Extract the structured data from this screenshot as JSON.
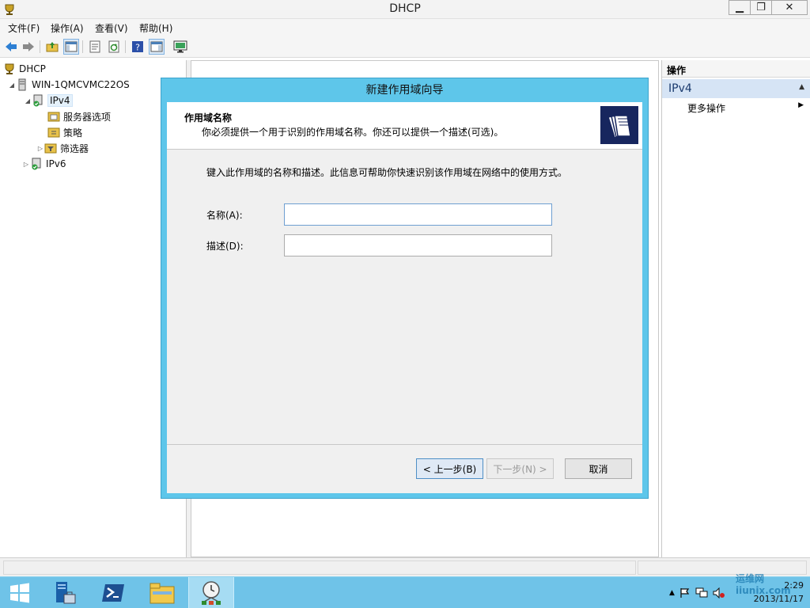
{
  "window": {
    "title": "DHCP",
    "min_glyph": "▁",
    "max_glyph": "❐",
    "close_glyph": "✕"
  },
  "menu": [
    "文件(F)",
    "操作(A)",
    "查看(V)",
    "帮助(H)"
  ],
  "toolbar": {
    "icons": [
      "back-arrow-icon",
      "forward-arrow-icon",
      "folder-up-icon",
      "show-hide-tree-icon",
      "properties-icon",
      "refresh-icon",
      "help-icon",
      "show-hide-action-pane-icon",
      "monitor-icon"
    ]
  },
  "tree": {
    "root": "DHCP",
    "server": "WIN-1QMCVMC22OS",
    "ipv4": "IPv4",
    "server_options": "服务器选项",
    "policies": "策略",
    "filters": "筛选器",
    "ipv6": "IPv6"
  },
  "actions": {
    "header": "操作",
    "section": "IPv4",
    "more": "更多操作"
  },
  "wizard": {
    "title": "新建作用域向导",
    "header_title": "作用域名称",
    "header_subtitle": "你必须提供一个用于识别的作用域名称。你还可以提供一个描述(可选)。",
    "instruction": "键入此作用域的名称和描述。此信息可帮助你快速识别该作用域在网络中的使用方式。",
    "name_label": "名称(A):",
    "name_value": "",
    "desc_label": "描述(D):",
    "desc_value": "",
    "back_button": "< 上一步(B)",
    "next_button": "下一步(N) >",
    "cancel_button": "取消"
  },
  "taskbar": {
    "buttons": [
      "start-icon",
      "server-manager-icon",
      "powershell-icon",
      "file-explorer-icon",
      "dhcp-console-icon"
    ]
  },
  "clock": {
    "time": "2:29",
    "date": "2013/11/17"
  },
  "watermark": "运维网 iiunix.com",
  "colors": {
    "taskbar": "#6fc3e8",
    "dialog_frame": "#5ec6ea",
    "action_section": "#d6e4f5"
  }
}
